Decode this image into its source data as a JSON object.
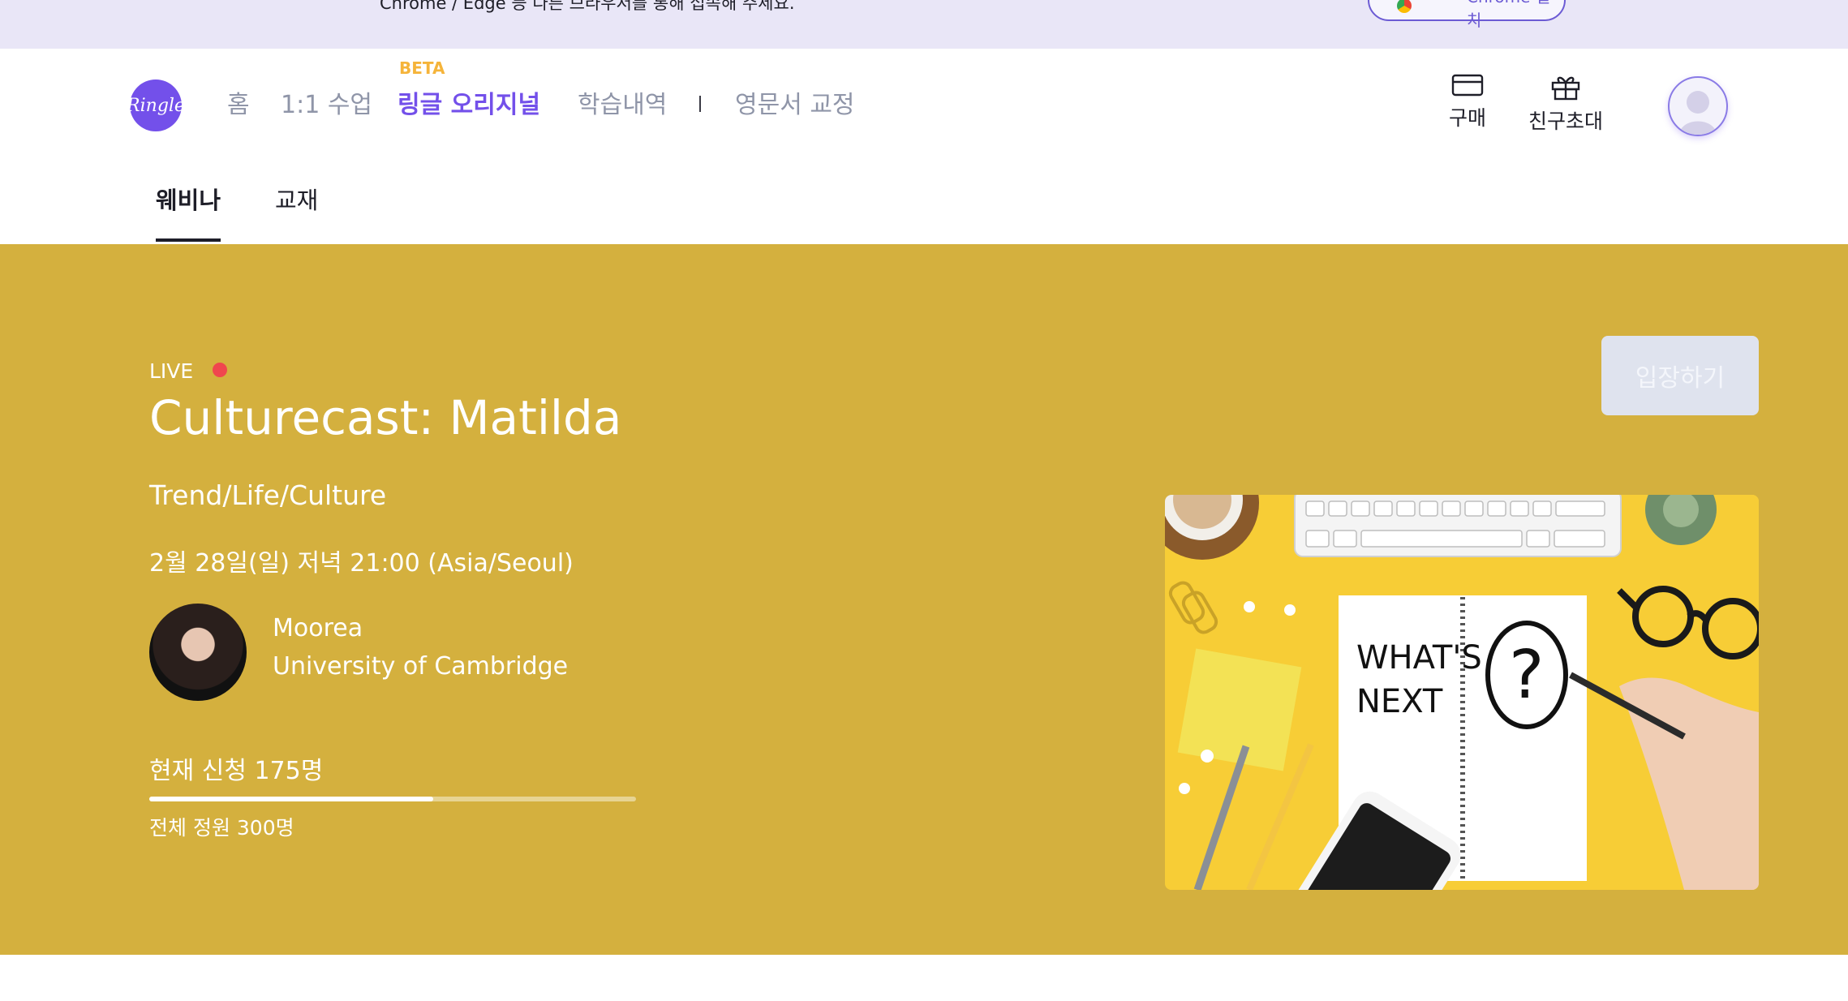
{
  "notice": {
    "text": "Chrome / Edge 등 다른 브라우저를 통해 접속해 주세요.",
    "button_label": "Chrome 설치"
  },
  "header": {
    "logo_text": "Ringle",
    "beta_badge": "BETA",
    "nav": [
      {
        "label": "홈"
      },
      {
        "label": "1:1 수업"
      },
      {
        "label": "링글 오리지널"
      },
      {
        "label": "학습내역"
      },
      {
        "label": "영문서 교정"
      }
    ],
    "purchase_label": "구매",
    "invite_label": "친구초대"
  },
  "tabs": [
    {
      "label": "웨비나"
    },
    {
      "label": "교재"
    }
  ],
  "webinar": {
    "live_label": "LIVE",
    "title": "Culturecast: Matilda",
    "category": "Trend/Life/Culture",
    "datetime": "2월 28일(일) 저녁 21:00 (Asia/Seoul)",
    "speaker_name": "Moorea",
    "speaker_org": "University of Cambridge",
    "applied_text": "현재 신청 175명",
    "capacity_text": "전체 정원 300명",
    "applied_count": 175,
    "capacity": 300,
    "enter_button": "입장하기",
    "thumbnail": {
      "line1": "WHAT'S",
      "line2": "NEXT"
    }
  },
  "colors": {
    "brand": "#7350ea",
    "hero_bg": "#d4b03e",
    "live_dot": "#f0464e",
    "beta": "#f5b43a"
  }
}
